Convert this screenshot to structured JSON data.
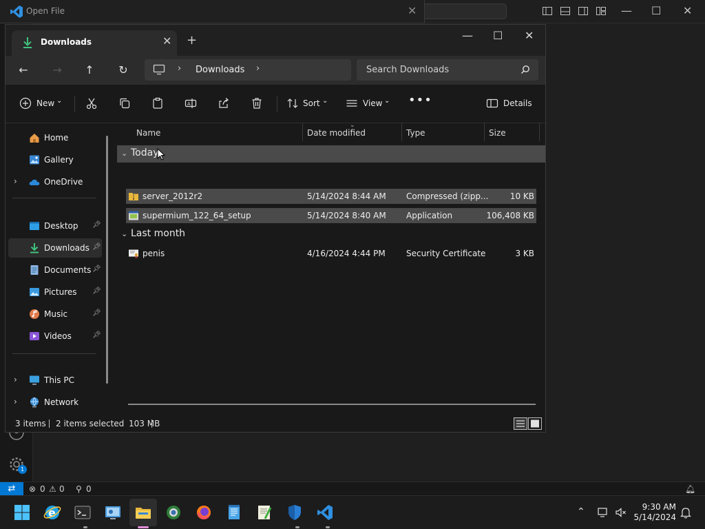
{
  "vscode": {
    "dialog_title": "Open File",
    "status": {
      "errors": "0",
      "warnings": "0",
      "ports": "0"
    },
    "settings_badge": "1"
  },
  "explorer": {
    "tab_label": "Downloads",
    "address": {
      "location": "Downloads"
    },
    "search": {
      "placeholder": "Search Downloads"
    },
    "commands": {
      "new": "New",
      "sort": "Sort",
      "view": "View",
      "details": "Details"
    },
    "sidebar": {
      "home": "Home",
      "gallery": "Gallery",
      "onedrive": "OneDrive",
      "desktop": "Desktop",
      "downloads": "Downloads",
      "documents": "Documents",
      "pictures": "Pictures",
      "music": "Music",
      "videos": "Videos",
      "this_pc": "This PC",
      "network": "Network"
    },
    "columns": {
      "name": "Name",
      "date": "Date modified",
      "type": "Type",
      "size": "Size"
    },
    "groups": [
      {
        "label": "Today",
        "files": [
          {
            "name": "server_2012r2",
            "date": "5/14/2024 8:44 AM",
            "type": "Compressed (zipp...",
            "size": "10 KB"
          },
          {
            "name": "supermium_122_64_setup",
            "date": "5/14/2024 8:40 AM",
            "type": "Application",
            "size": "106,408 KB"
          }
        ]
      },
      {
        "label": "Last month",
        "files": [
          {
            "name": "penis",
            "date": "4/16/2024 4:44 PM",
            "type": "Security Certificate",
            "size": "3 KB"
          }
        ]
      }
    ],
    "status": {
      "items": "3 items",
      "selected": "2 items selected",
      "size": "103 MB"
    }
  },
  "taskbar": {
    "time": "9:30 AM",
    "date": "5/14/2024"
  },
  "colors": {
    "accent": "#0078d4",
    "selection": "#4a4a4a",
    "folder_yellow": "#e8b83a"
  }
}
